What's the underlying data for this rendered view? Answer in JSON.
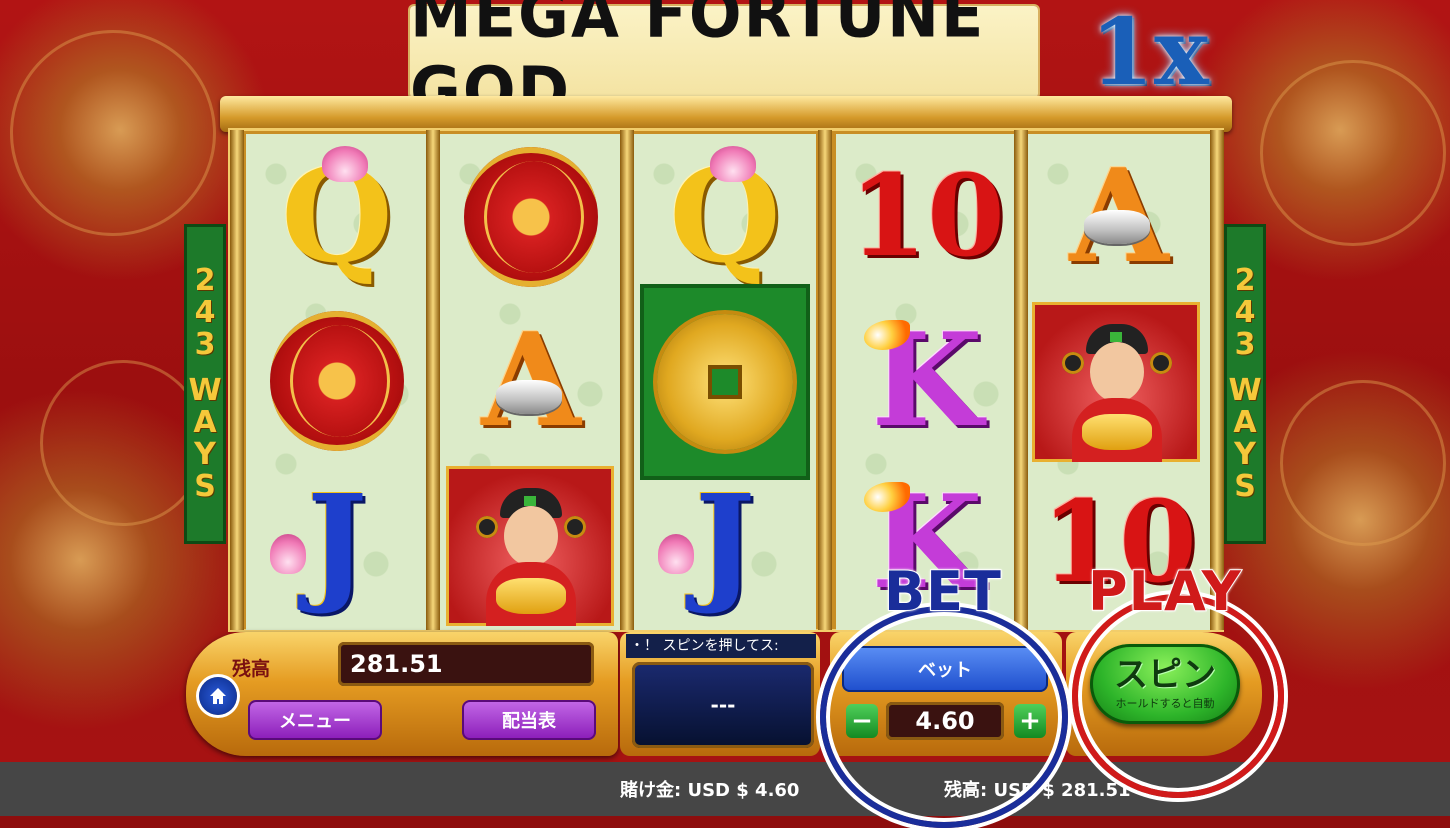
{
  "game": {
    "title": "MEGA FORTUNE GOD",
    "multiplier": "1x",
    "ways_left": [
      "2",
      "4",
      "3",
      "W",
      "A",
      "Y",
      "S"
    ],
    "ways_right": [
      "2",
      "4",
      "3",
      "W",
      "A",
      "Y",
      "S"
    ]
  },
  "reels": {
    "reel1": {
      "row1": "Q",
      "row2": "lantern",
      "row3": "J"
    },
    "reel2": {
      "row1": "lantern",
      "row2": "A",
      "row3": "fortune-god"
    },
    "reel3": {
      "row1": "Q",
      "row2": "coin",
      "row3": "J"
    },
    "reel4": {
      "row1": "10",
      "row2": "K",
      "row3": "K"
    },
    "reel5": {
      "row1": "A",
      "row2": "fortune-god",
      "row3": "10"
    }
  },
  "controls": {
    "balance_label": "残高",
    "balance_value": "281.51",
    "menu_label": "メニュー",
    "paytable_label": "配当表",
    "message": "・！ スピンを押してス:",
    "win_value": "---",
    "bet_label": "ベット",
    "bet_value": "4.60",
    "minus_label": "−",
    "plus_label": "+",
    "spin_label": "スピン",
    "spin_sub": "ホールドすると自動"
  },
  "annotations": {
    "bet_label": "BET",
    "play_label": "PLAY",
    "bet_color": "#1a2d9a",
    "play_color": "#d01a1a"
  },
  "status_bar": {
    "bet": "賭け金: USD $ 4.60",
    "balance": "残高: USD $ 281.51"
  },
  "icons": {
    "home": "home-icon"
  }
}
